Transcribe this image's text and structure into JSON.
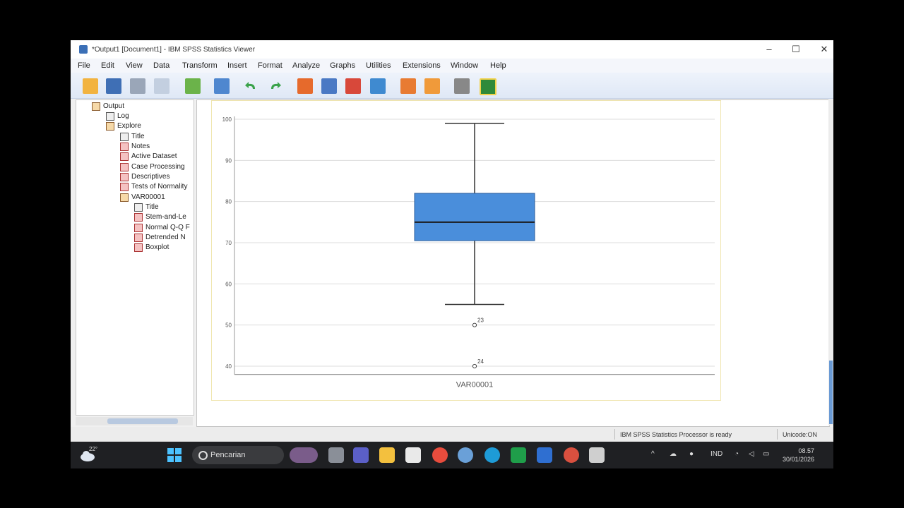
{
  "window": {
    "title": "*Output1 [Document1] - IBM SPSS Statistics Viewer",
    "controls": {
      "minimize": "–",
      "maximize": "☐",
      "close": "✕"
    }
  },
  "menu": [
    {
      "label": "File"
    },
    {
      "label": "Edit"
    },
    {
      "label": "View"
    },
    {
      "label": "Data"
    },
    {
      "label": "Transform"
    },
    {
      "label": "Insert"
    },
    {
      "label": "Format"
    },
    {
      "label": "Analyze"
    },
    {
      "label": "Graphs"
    },
    {
      "label": "Utilities"
    },
    {
      "label": "Extensions"
    },
    {
      "label": "Window"
    },
    {
      "label": "Help"
    }
  ],
  "toolbar": [
    "open-icon",
    "save-icon",
    "print-icon",
    "print-preview-icon",
    "export-icon",
    "recall-dialog-icon",
    "undo-icon",
    "redo-icon",
    "goto-data-icon",
    "goto-case-icon",
    "goto-variable-icon",
    "variables-icon",
    "insert-output-icon",
    "promote-icon",
    "designate-window-icon",
    "run-script-icon"
  ],
  "navigator": {
    "items": [
      {
        "label": "Output",
        "icon": "book-icon"
      },
      {
        "label": "Log",
        "icon": "log-icon"
      },
      {
        "label": "Explore",
        "icon": "book-icon"
      },
      {
        "label": "Title",
        "icon": "title-icon"
      },
      {
        "label": "Notes",
        "icon": "notes-icon"
      },
      {
        "label": "Active Dataset",
        "icon": "table-icon"
      },
      {
        "label": "Case Processing",
        "icon": "table-icon"
      },
      {
        "label": "Descriptives",
        "icon": "table-icon"
      },
      {
        "label": "Tests of Normality",
        "icon": "table-icon"
      },
      {
        "label": "VAR00001",
        "icon": "book-icon"
      },
      {
        "label": "Title",
        "icon": "title-icon"
      },
      {
        "label": "Stem-and-Le",
        "icon": "chart-icon"
      },
      {
        "label": "Normal Q-Q F",
        "icon": "chart-icon"
      },
      {
        "label": "Detrended N",
        "icon": "chart-icon"
      },
      {
        "label": "Boxplot",
        "icon": "chart-icon"
      }
    ]
  },
  "chart_data": {
    "type": "boxplot",
    "category": "VAR00001",
    "xlabel": "VAR00001",
    "ylim": [
      38,
      100
    ],
    "yticks": [
      40,
      50,
      60,
      70,
      80,
      90,
      100
    ],
    "box": {
      "whisker_low": 55,
      "q1": 70.5,
      "median": 75,
      "q3": 82,
      "whisker_high": 99
    },
    "outliers": [
      {
        "value": 50,
        "label": "23"
      },
      {
        "value": 40,
        "label": "24"
      }
    ],
    "box_color": "#4a8edb",
    "grid": true
  },
  "status": {
    "processor": "IBM SPSS Statistics Processor is ready",
    "encoding": "Unicode:ON"
  },
  "taskbar": {
    "temperature": "22°",
    "search_placeholder": "Pencarian",
    "language": "IND",
    "time": "08.57",
    "date": "30/01/2026"
  }
}
